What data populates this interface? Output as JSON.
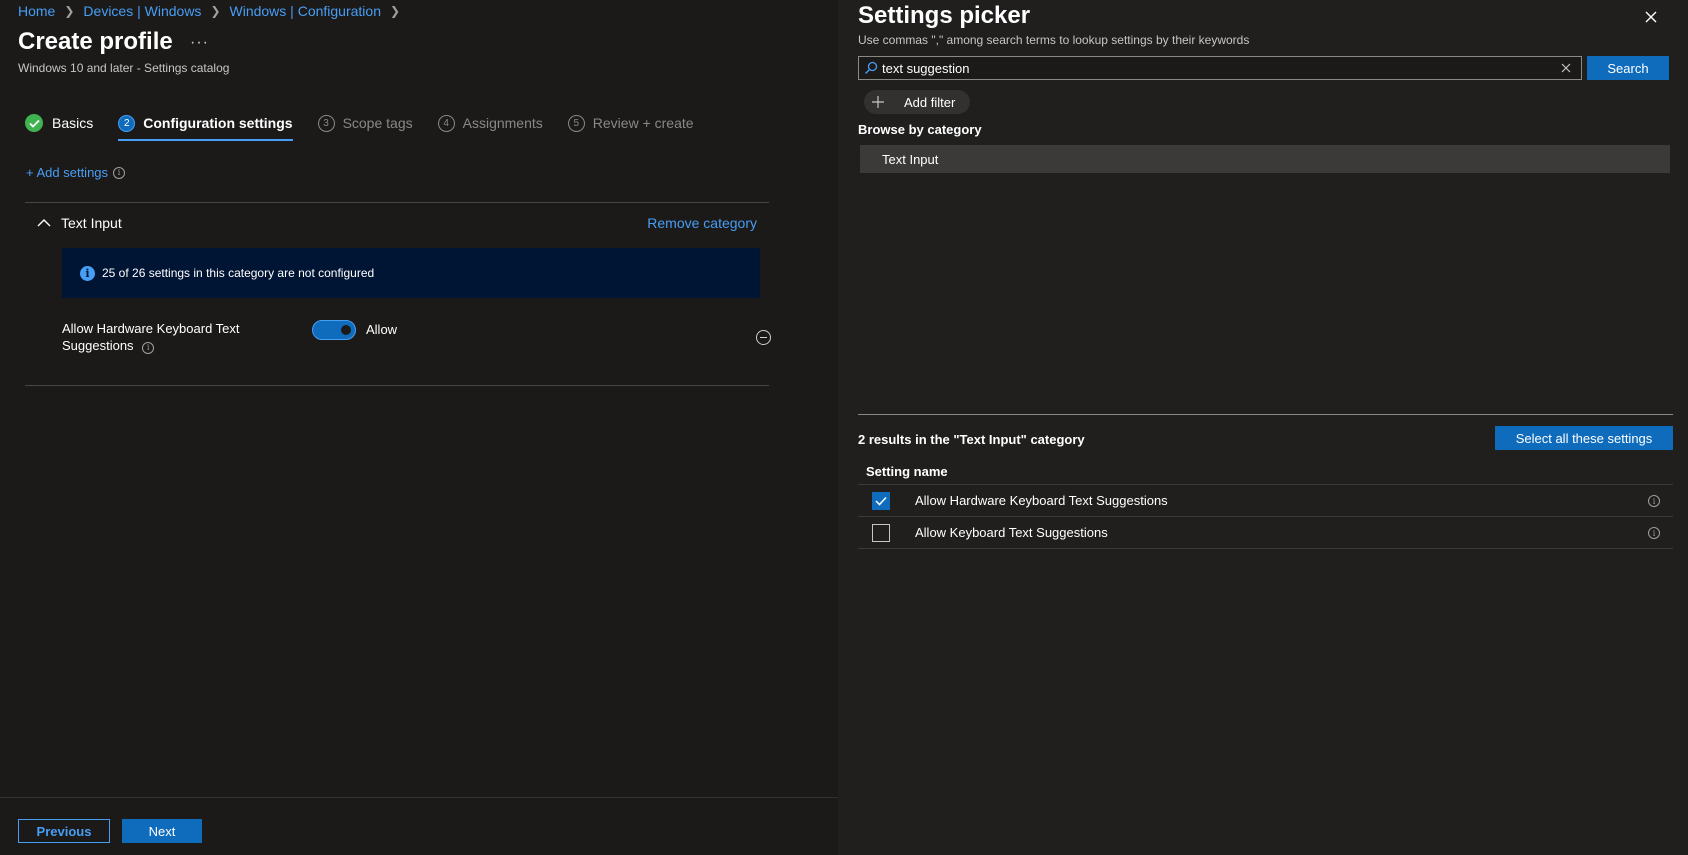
{
  "breadcrumb": [
    "Home",
    "Devices | Windows",
    "Windows | Configuration"
  ],
  "header": {
    "title": "Create profile",
    "more": "···",
    "subtitle": "Windows 10 and later - Settings catalog"
  },
  "wizard": {
    "steps": [
      {
        "number": "1",
        "label": "Basics",
        "state": "completed"
      },
      {
        "number": "2",
        "label": "Configuration settings",
        "state": "current"
      },
      {
        "number": "3",
        "label": "Scope tags",
        "state": "upcoming"
      },
      {
        "number": "4",
        "label": "Assignments",
        "state": "upcoming"
      },
      {
        "number": "5",
        "label": "Review + create",
        "state": "upcoming"
      }
    ]
  },
  "add_settings_label": "+ Add settings",
  "category": {
    "name": "Text Input",
    "remove_label": "Remove category",
    "banner": "25 of 26 settings in this category are not configured",
    "setting": {
      "name": "Allow Hardware Keyboard Text Suggestions",
      "toggle_on": true,
      "value_label": "Allow"
    }
  },
  "footer": {
    "previous_label": "Previous",
    "next_label": "Next"
  },
  "picker": {
    "title": "Settings picker",
    "hint": "Use commas \",\" among search terms to lookup settings by their keywords",
    "search_value": "text suggestion",
    "search_button": "Search",
    "add_filter": "Add filter",
    "browse_label": "Browse by category",
    "categories": [
      "Text Input"
    ],
    "results_count": "2 results in the \"Text Input\" category",
    "select_all": "Select all these settings",
    "column_header": "Setting name",
    "results": [
      {
        "name": "Allow Hardware Keyboard Text Suggestions",
        "checked": true
      },
      {
        "name": "Allow Keyboard Text Suggestions",
        "checked": false
      }
    ]
  },
  "colors": {
    "accent": "#479ef5",
    "primary_button": "#0f6cbd",
    "success": "#3fb34f",
    "banner_bg": "#001433"
  }
}
